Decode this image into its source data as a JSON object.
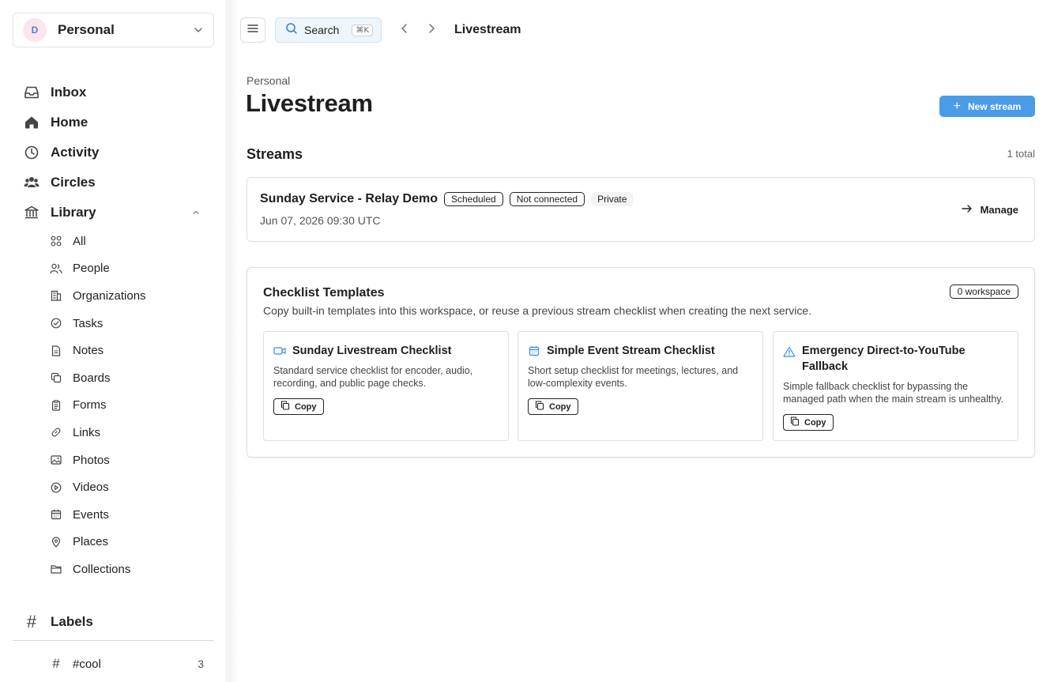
{
  "workspace": {
    "initial": "D",
    "name": "Personal"
  },
  "nav": {
    "main": [
      {
        "label": "Inbox",
        "icon": "inbox-icon"
      },
      {
        "label": "Home",
        "icon": "home-icon"
      },
      {
        "label": "Activity",
        "icon": "clock-icon"
      },
      {
        "label": "Circles",
        "icon": "people-group-icon"
      },
      {
        "label": "Library",
        "icon": "library-icon",
        "expanded": true
      }
    ],
    "library": [
      {
        "label": "All",
        "icon": "grid-icon"
      },
      {
        "label": "People",
        "icon": "people-icon"
      },
      {
        "label": "Organizations",
        "icon": "building-icon"
      },
      {
        "label": "Tasks",
        "icon": "check-circle-icon"
      },
      {
        "label": "Notes",
        "icon": "note-icon"
      },
      {
        "label": "Boards",
        "icon": "boards-icon"
      },
      {
        "label": "Forms",
        "icon": "form-icon"
      },
      {
        "label": "Links",
        "icon": "link-icon"
      },
      {
        "label": "Photos",
        "icon": "photo-icon"
      },
      {
        "label": "Videos",
        "icon": "play-circle-icon"
      },
      {
        "label": "Events",
        "icon": "calendar-icon"
      },
      {
        "label": "Places",
        "icon": "pin-icon"
      },
      {
        "label": "Collections",
        "icon": "folder-icon"
      }
    ],
    "labels_heading": "Labels",
    "labels": [
      {
        "label": "#cool",
        "count": "3"
      }
    ]
  },
  "topbar": {
    "search_label": "Search",
    "search_shortcut": "⌘K",
    "title": "Livestream"
  },
  "page": {
    "workspace": "Personal",
    "title": "Livestream",
    "new_button": "New stream",
    "accent_color": "#4a9ce8"
  },
  "streams": {
    "heading": "Streams",
    "total": "1 total",
    "items": [
      {
        "name": "Sunday Service - Relay Demo",
        "badges": [
          "Scheduled",
          "Not connected"
        ],
        "visibility": "Private",
        "date": "Jun 07, 2026 09:30 UTC",
        "action": "Manage"
      }
    ]
  },
  "templates": {
    "heading": "Checklist Templates",
    "subtitle": "Copy built-in templates into this workspace, or reuse a previous stream checklist when creating the next service.",
    "badge": "0 workspace",
    "items": [
      {
        "icon": "video-icon",
        "name": "Sunday Livestream Checklist",
        "description": "Standard service checklist for encoder, audio, recording, and public page checks.",
        "action": "Copy"
      },
      {
        "icon": "calendar-icon",
        "name": "Simple Event Stream Checklist",
        "description": "Short setup checklist for meetings, lectures, and low-complexity events.",
        "action": "Copy"
      },
      {
        "icon": "warning-icon",
        "name": "Emergency Direct-to-YouTube Fallback",
        "description": "Simple fallback checklist for bypassing the managed path when the main stream is unhealthy.",
        "action": "Copy"
      }
    ]
  }
}
